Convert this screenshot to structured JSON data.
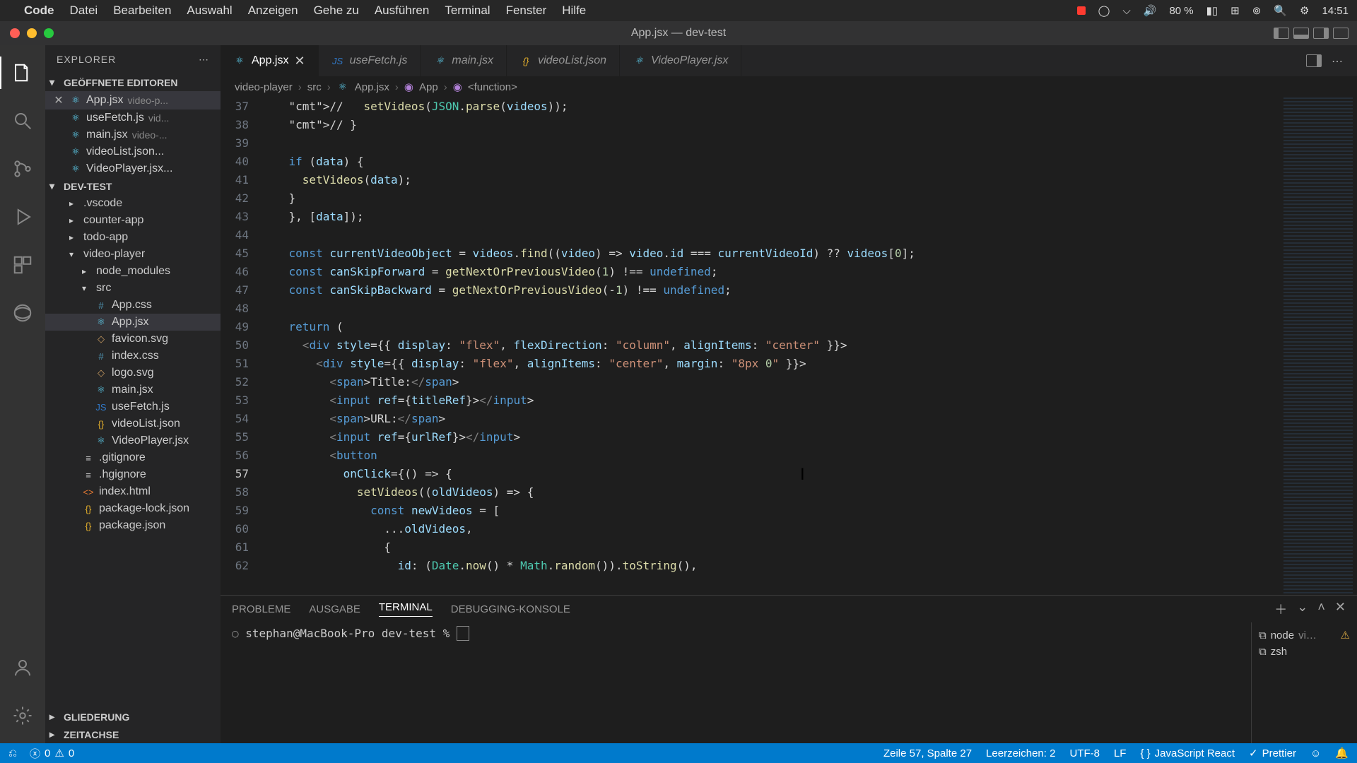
{
  "macmenu": {
    "app": "Code",
    "items": [
      "Datei",
      "Bearbeiten",
      "Auswahl",
      "Anzeigen",
      "Gehe zu",
      "Ausführen",
      "Terminal",
      "Fenster",
      "Hilfe"
    ],
    "battery": "80 %",
    "time": "14:51"
  },
  "window": {
    "title": "App.jsx — dev-test"
  },
  "sidebar": {
    "title": "EXPLORER",
    "open_editors_label": "GEÖFFNETE EDITOREN",
    "open_editors": [
      {
        "name": "App.jsx",
        "path": "video-p...",
        "active": true
      },
      {
        "name": "useFetch.js",
        "path": "vid..."
      },
      {
        "name": "main.jsx",
        "path": "video-..."
      },
      {
        "name": "videoList.json...",
        "path": ""
      },
      {
        "name": "VideoPlayer.jsx...",
        "path": ""
      }
    ],
    "workspace": "DEV-TEST",
    "tree": [
      {
        "depth": 1,
        "kind": "folder",
        "open": false,
        "name": ".vscode"
      },
      {
        "depth": 1,
        "kind": "folder",
        "open": false,
        "name": "counter-app"
      },
      {
        "depth": 1,
        "kind": "folder",
        "open": false,
        "name": "todo-app"
      },
      {
        "depth": 1,
        "kind": "folder",
        "open": true,
        "name": "video-player"
      },
      {
        "depth": 2,
        "kind": "folder",
        "open": false,
        "name": "node_modules"
      },
      {
        "depth": 2,
        "kind": "folder",
        "open": true,
        "name": "src"
      },
      {
        "depth": 3,
        "kind": "file",
        "icon": "css",
        "name": "App.css"
      },
      {
        "depth": 3,
        "kind": "file",
        "icon": "react",
        "name": "App.jsx",
        "active": true
      },
      {
        "depth": 3,
        "kind": "file",
        "icon": "svg",
        "name": "favicon.svg"
      },
      {
        "depth": 3,
        "kind": "file",
        "icon": "css",
        "name": "index.css"
      },
      {
        "depth": 3,
        "kind": "file",
        "icon": "svg",
        "name": "logo.svg"
      },
      {
        "depth": 3,
        "kind": "file",
        "icon": "react",
        "name": "main.jsx"
      },
      {
        "depth": 3,
        "kind": "file",
        "icon": "ts",
        "name": "useFetch.js"
      },
      {
        "depth": 3,
        "kind": "file",
        "icon": "json",
        "name": "videoList.json"
      },
      {
        "depth": 3,
        "kind": "file",
        "icon": "react",
        "name": "VideoPlayer.jsx"
      },
      {
        "depth": 2,
        "kind": "file",
        "icon": "file",
        "name": ".gitignore"
      },
      {
        "depth": 2,
        "kind": "file",
        "icon": "file",
        "name": ".hgignore"
      },
      {
        "depth": 2,
        "kind": "file",
        "icon": "html",
        "name": "index.html"
      },
      {
        "depth": 2,
        "kind": "file",
        "icon": "json",
        "name": "package-lock.json"
      },
      {
        "depth": 2,
        "kind": "file",
        "icon": "json",
        "name": "package.json"
      }
    ],
    "outline": "GLIEDERUNG",
    "timeline": "ZEITACHSE"
  },
  "tabs": [
    {
      "name": "App.jsx",
      "active": true,
      "icon": "react"
    },
    {
      "name": "useFetch.js",
      "icon": "ts"
    },
    {
      "name": "main.jsx",
      "icon": "react"
    },
    {
      "name": "videoList.json",
      "icon": "json"
    },
    {
      "name": "VideoPlayer.jsx",
      "icon": "react"
    }
  ],
  "breadcrumb": [
    "video-player",
    "src",
    "App.jsx",
    "App",
    "<function>"
  ],
  "code": {
    "first_line": 37,
    "active_line": 57,
    "lines": [
      "//   setVideos(JSON.parse(videos));",
      "// }",
      "",
      "if (data) {",
      "  setVideos(data);",
      "}",
      "}, [data]);",
      "",
      "const currentVideoObject = videos.find((video) => video.id === currentVideoId) ?? videos[0];",
      "const canSkipForward = getNextOrPreviousVideo(1) !== undefined;",
      "const canSkipBackward = getNextOrPreviousVideo(-1) !== undefined;",
      "",
      "return (",
      "  <div style={{ display: \"flex\", flexDirection: \"column\", alignItems: \"center\" }}>",
      "    <div style={{ display: \"flex\", alignItems: \"center\", margin: \"8px 0\" }}>",
      "      <span>Title:</span>",
      "      <input ref={titleRef}></input>",
      "      <span>URL:</span>",
      "      <input ref={urlRef}></input>",
      "      <button",
      "        onClick={() => {",
      "          setVideos((oldVideos) => {",
      "            const newVideos = [",
      "              ...oldVideos,",
      "              {",
      "                id: (Date.now() * Math.random()).toString(),"
    ]
  },
  "panel": {
    "tabs": [
      "PROBLEME",
      "AUSGABE",
      "TERMINAL",
      "DEBUGGING-KONSOLE"
    ],
    "active": "TERMINAL",
    "prompt": "stephan@MacBook-Pro dev-test % ",
    "sessions": [
      {
        "name": "node",
        "sub": "vi…",
        "warn": true
      },
      {
        "name": "zsh"
      }
    ]
  },
  "status": {
    "remote": "",
    "errors": "0",
    "warnings": "0",
    "cursor": "Zeile 57, Spalte 27",
    "indent": "Leerzeichen: 2",
    "encoding": "UTF-8",
    "eol": "LF",
    "lang": "JavaScript React",
    "prettier": "Prettier"
  }
}
